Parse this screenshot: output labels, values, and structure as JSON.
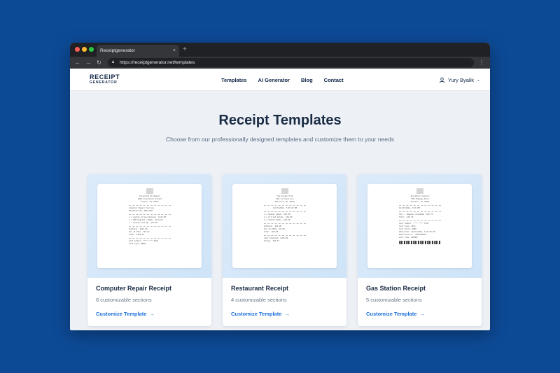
{
  "browser": {
    "tab_title": "Receiptgenerator",
    "tab_close": "×",
    "new_tab": "+",
    "url": "https://receiptgenerator.net/templates"
  },
  "site": {
    "logo_line1": "RECEIPT",
    "logo_line2": "GENERATOR",
    "nav": [
      "Templates",
      "AI Generator",
      "Blog",
      "Contact"
    ],
    "user_name": "Yury Byalik"
  },
  "hero": {
    "title": "Receipt Templates",
    "subtitle": "Choose from our professionally designed templates and customize them to your needs"
  },
  "cards": [
    {
      "title": "Computer Repair Receipt",
      "sections": "6 customizable sections",
      "link": "Customize Template",
      "receipt_lines": [
        "Excellent PC Repair",
        "2410 Innovation Street",
        "Austin, TX 78702",
        "Computer Repair Service",
        "Mainboard No. SB0-2847",
        "1 x Laptop Screen Removal  $129.00",
        "1 x RAM Upgrade (16GB)  $110.00",
        "1 x System Tune-Up  $75.00",
        "Subtotal  $314.00",
        "Tax (8.25%)  $25.91",
        "Total  $339.91",
        "Card number: **** **** 4821",
        "Card type: DEBIT"
      ]
    },
    {
      "title": "Restaurant Receipt",
      "sections": "4 customizable sections",
      "link": "Customize Template",
      "receipt_lines": [
        "The Golden Fork",
        "456 Culinary Ave",
        "New York, NY 10001",
        "12/15/2024, 7:45:32 PM",
        "1 x Caesar Salad  $14.00",
        "2 x Grilled Salmon  $32.00",
        "1 x Tomato Pasta  $18.00",
        "Subtotal  $64.00",
        "Tax (8.875%)  $5.68",
        "Total  $69.68",
        "Cash Tendered  $100.00",
        "Change  $30.32"
      ]
    },
    {
      "title": "Gas Station Receipt",
      "sections": "5 customizable sections",
      "link": "Customize Template",
      "receipt_lines": [
        "QuickFuel Station",
        "789 Highway Blvd",
        "Houston, TX 77002",
        "12/15/2024, 3:45 PM",
        "Fill • Regular Unleaded  $45.75",
        "Total  $45.75",
        "Card number: **** **** 7234",
        "Card type: VISA",
        "Card entry: CHIP",
        "Date/time: 12/15/2024, 3:45:55 PM",
        "Reference no.: 0007489632",
        "Auth code: 4P9H6X"
      ]
    }
  ],
  "colors": {
    "background": "#0d4a96",
    "heading": "#1a2b44",
    "link": "#1a6fd9"
  }
}
